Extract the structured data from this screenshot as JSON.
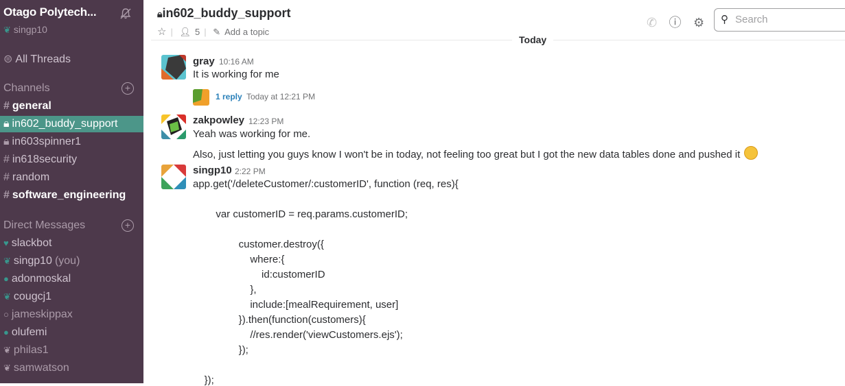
{
  "sidebar": {
    "team_name": "Otago Polytech...",
    "current_user": "singp10",
    "all_threads": "All Threads",
    "channels_header": "Channels",
    "channels": [
      {
        "name": "general",
        "state": "unread"
      },
      {
        "name": "in602_buddy_support",
        "state": "active"
      },
      {
        "name": "in603spinner1",
        "state": "private"
      },
      {
        "name": "in618security",
        "state": "normal"
      },
      {
        "name": "random",
        "state": "normal"
      },
      {
        "name": "software_engineering",
        "state": "unread"
      }
    ],
    "dm_header": "Direct Messages",
    "dms": [
      {
        "name": "slackbot",
        "suffix": ""
      },
      {
        "name": "singp10",
        "suffix": "(you)"
      },
      {
        "name": "adonmoskal",
        "suffix": ""
      },
      {
        "name": "cougcj1",
        "suffix": ""
      },
      {
        "name": "jameskippax",
        "suffix": ""
      },
      {
        "name": "olufemi",
        "suffix": ""
      },
      {
        "name": "philas1",
        "suffix": ""
      },
      {
        "name": "samwatson",
        "suffix": ""
      }
    ]
  },
  "header": {
    "channel_name": "in602_buddy_support",
    "member_count": "5",
    "add_topic": "Add a topic",
    "search_placeholder": "Search"
  },
  "day_divider": "Today",
  "messages": [
    {
      "author": "gray",
      "time": "10:16 AM",
      "lines": [
        "It is working for me"
      ]
    },
    {
      "author": "zakpowley",
      "time": "12:23 PM",
      "lines": [
        "Yeah was working for me.",
        "Also, just letting you guys know I won't be in today, not feeling too great but I got the new data tables done and pushed it"
      ]
    },
    {
      "author": "singp10",
      "time": "2:22 PM",
      "lines": [
        "app.get('/deleteCustomer/:customerID', function (req, res){",
        "",
        "        var customerID = req.params.customerID;",
        "",
        "                customer.destroy({",
        "                    where:{",
        "                        id:customerID",
        "                    },",
        "                    include:[mealRequirement, user]",
        "                }).then(function(customers){",
        "                    //res.render('viewCustomers.ejs');",
        "                });",
        "",
        "",
        "    });"
      ]
    }
  ],
  "thread": {
    "reply_label": "1 reply",
    "reply_time": "Today at 12:21 PM"
  },
  "colors": {
    "sidebar_bg": "#4d394b",
    "active_channel": "#4c9689",
    "link": "#2a80b9"
  }
}
